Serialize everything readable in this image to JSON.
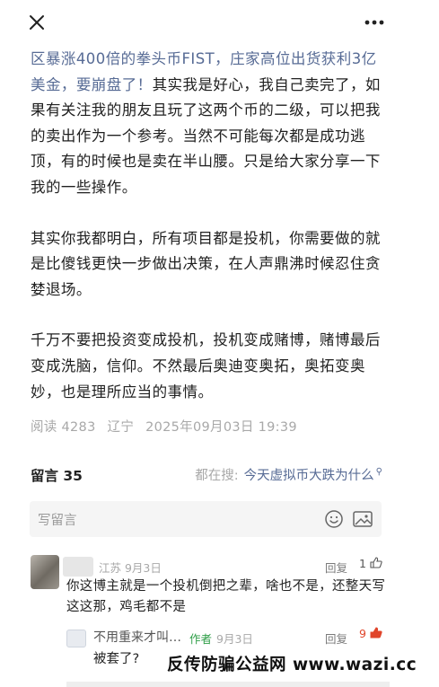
{
  "topbar": {
    "close_icon": "close-icon",
    "more_icon": "more-dots-icon"
  },
  "article": {
    "p1_link": "区暴涨400倍的拳头币FIST，庄家高位出货获利3亿美金，要崩盘了！",
    "p1_rest": "其实我是好心，我自己卖完了，如果有关注我的朋友且玩了这两个币的二级，可以把我的卖出作为一个参考。当然不可能每次都是成功逃顶，有的时候也是卖在半山腰。只是给大家分享一下我的一些操作。",
    "p2": "其实你我都明白，所有项目都是投机，你需要做的就是比傻钱更快一步做出决策，在人声鼎沸时候忍住贪婪退场。",
    "p3": "千万不要把投资变成投机，投机变成赌博，赌博最后变成洗脑，信仰。不然最后奥迪变奥拓，奥拓变奥妙，也是理所应当的事情。"
  },
  "meta": {
    "reads": "阅读 4283",
    "location": "辽宁",
    "datetime": "2025年09月03日 19:39"
  },
  "comments": {
    "title": "留言 35",
    "searching_label": "都在搜:",
    "searching_query": "今天虚拟币大跌为什么",
    "compose_placeholder": "写留言",
    "items": [
      {
        "location_date": "江苏 9月3日",
        "reply_label": "回复",
        "likes": "1",
        "text": "你这博主就是一个投机倒把之辈，啥也不是，还整天写这这那，鸡毛都不是",
        "reply": {
          "name": "不用重来才叫…",
          "tag": "作者",
          "date": "9月3日",
          "reply_label": "回复",
          "likes": "9",
          "text": "被套了?"
        }
      }
    ]
  },
  "watermark": "反传防骗公益网 www.wazi.cc",
  "colors": {
    "link": "#576b95",
    "author_tag": "#2e9e47",
    "liked": "#e0452b"
  }
}
